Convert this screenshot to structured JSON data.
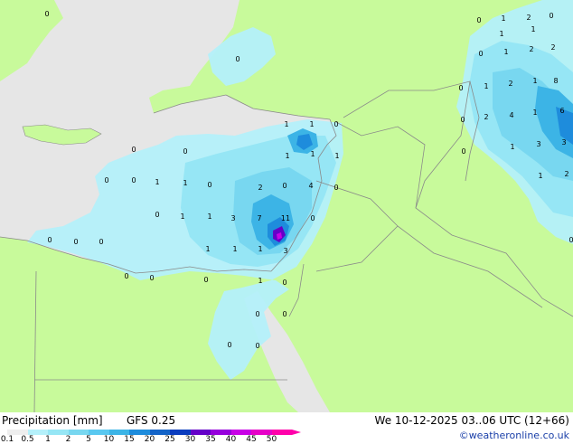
{
  "footer": {
    "title": "Precipitation [mm]",
    "model": "GFS 0.25",
    "valid_time": "We 10-12-2025 03..06 UTC (12+66)",
    "credit": "©weatheronline.co.uk"
  },
  "legend": {
    "ticks": [
      "0.1",
      "0.5",
      "1",
      "2",
      "5",
      "10",
      "15",
      "20",
      "25",
      "30",
      "35",
      "40",
      "45",
      "50"
    ],
    "colors": [
      "#eeeeee",
      "#b4f0fa",
      "#96e6f5",
      "#78d7f0",
      "#5ac8f0",
      "#3cb4e6",
      "#1e8cdc",
      "#1464c8",
      "#0a3cbe",
      "#6400c8",
      "#9600dc",
      "#c800e6",
      "#e600c8",
      "#ff00aa"
    ]
  },
  "map": {
    "land_color": "#c8fa9b",
    "sea_color": "#e6e6e6",
    "value_labels": [
      {
        "t": "0"
      },
      {
        "t": "0"
      },
      {
        "t": "1"
      },
      {
        "t": "2"
      },
      {
        "t": "0"
      },
      {
        "t": "1"
      },
      {
        "t": "1"
      },
      {
        "t": "0"
      },
      {
        "t": "1"
      },
      {
        "t": "2"
      },
      {
        "t": "2"
      },
      {
        "t": "8"
      },
      {
        "t": "0"
      },
      {
        "t": "1"
      },
      {
        "t": "2"
      },
      {
        "t": "1"
      },
      {
        "t": "0"
      },
      {
        "t": "2"
      },
      {
        "t": "4"
      },
      {
        "t": "1"
      },
      {
        "t": "6"
      },
      {
        "t": "0"
      },
      {
        "t": "1"
      },
      {
        "t": "3"
      },
      {
        "t": "3"
      },
      {
        "t": "1"
      },
      {
        "t": "2"
      },
      {
        "t": "0"
      },
      {
        "t": "0"
      },
      {
        "t": "1"
      },
      {
        "t": "1"
      },
      {
        "t": "0"
      },
      {
        "t": "0"
      },
      {
        "t": "1"
      },
      {
        "t": "1"
      },
      {
        "t": "1"
      },
      {
        "t": "0"
      },
      {
        "t": "0"
      },
      {
        "t": "0"
      },
      {
        "t": "1"
      },
      {
        "t": "0"
      },
      {
        "t": "2"
      },
      {
        "t": "0"
      },
      {
        "t": "4"
      },
      {
        "t": "0"
      },
      {
        "t": "0"
      },
      {
        "t": "1"
      },
      {
        "t": "1"
      },
      {
        "t": "3"
      },
      {
        "t": "7"
      },
      {
        "t": "11"
      },
      {
        "t": "0"
      },
      {
        "t": "0"
      },
      {
        "t": "0"
      },
      {
        "t": "1"
      },
      {
        "t": "1"
      },
      {
        "t": "1"
      },
      {
        "t": "3"
      },
      {
        "t": "0"
      },
      {
        "t": "0"
      },
      {
        "t": "0"
      },
      {
        "t": "0"
      },
      {
        "t": "1"
      },
      {
        "t": "0"
      },
      {
        "t": "0"
      },
      {
        "t": "0"
      },
      {
        "t": "0"
      },
      {
        "t": "1"
      },
      {
        "t": "0"
      }
    ]
  }
}
